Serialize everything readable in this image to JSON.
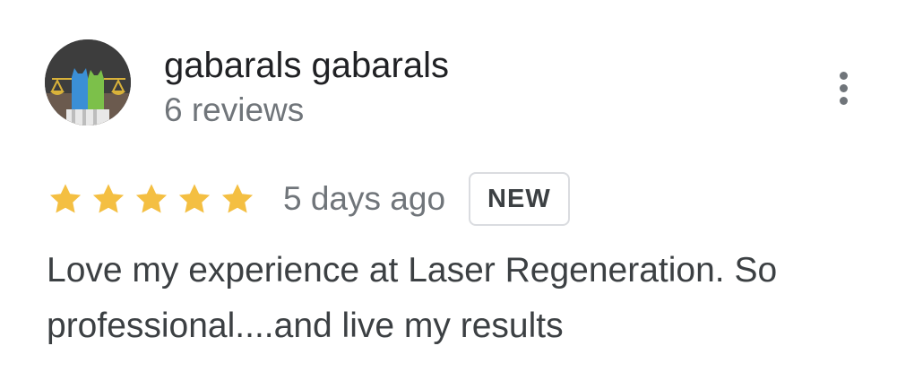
{
  "reviewer": {
    "name": "gabarals gabarals",
    "review_count": "6 reviews",
    "avatar_icon": "avatar-cats-scales-icon"
  },
  "menu": {
    "icon": "more-vert-icon"
  },
  "review": {
    "rating": 5,
    "rating_max": 5,
    "star_color": "#f4bf42",
    "date": "5 days ago",
    "badge": "NEW",
    "text": "Love my experience at Laser Regeneration. So professional....and live my results"
  }
}
